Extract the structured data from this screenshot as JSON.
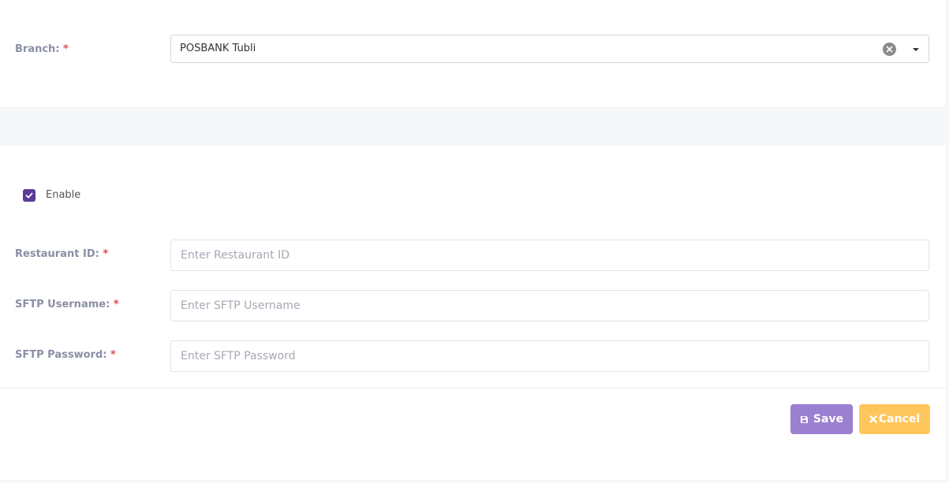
{
  "branch": {
    "label": "Branch:",
    "required_mark": "*",
    "selected_value": "POSBANK Tubli"
  },
  "settings": {
    "enable_label": "Enable",
    "enable_checked": true,
    "restaurant_id": {
      "label": "Restaurant ID:",
      "required_mark": "*",
      "placeholder": "Enter Restaurant ID",
      "value": ""
    },
    "sftp_username": {
      "label": "SFTP Username:",
      "required_mark": "*",
      "placeholder": "Enter SFTP Username",
      "value": ""
    },
    "sftp_password": {
      "label": "SFTP Password:",
      "required_mark": "*",
      "placeholder": "Enter SFTP Password",
      "value": ""
    }
  },
  "actions": {
    "save_label": "Save",
    "save_icon": "floppy-disk-icon",
    "cancel_label": "Cancel",
    "cancel_icon": "times-icon"
  },
  "colors": {
    "accent": "#5b3c9c",
    "save_button": "#9b7fd0",
    "cancel_button": "#ffc65c",
    "required": "#e5484d"
  }
}
